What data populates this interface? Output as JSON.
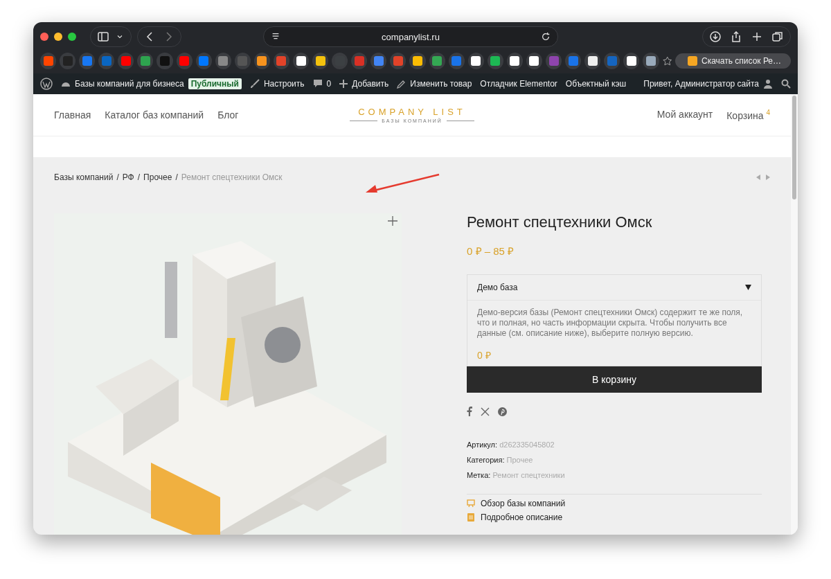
{
  "browser": {
    "address": "companylist.ru",
    "bookmark_tab": "Скачать список Ре…"
  },
  "admin_bar": {
    "site": "Базы компаний для бизнеса",
    "badge": "Публичный",
    "items": [
      {
        "kind": "customize",
        "label": "Настроить"
      },
      {
        "kind": "comments",
        "label": "0"
      },
      {
        "kind": "add",
        "label": "Добавить"
      },
      {
        "kind": "edit",
        "label": "Изменить товар"
      },
      {
        "kind": "plain",
        "label": "Отладчик Elementor"
      },
      {
        "kind": "plain",
        "label": "Объектный кэш"
      }
    ],
    "greeting": "Привет, Администратор сайта"
  },
  "nav": {
    "left": [
      "Главная",
      "Каталог баз компаний",
      "Блог"
    ],
    "logo": {
      "title": "COMPANY LIST",
      "subtitle": "БАЗЫ КОМПАНИЙ"
    },
    "account": "Мой аккаунт",
    "cart": "Корзина",
    "cart_count": "4"
  },
  "breadcrumbs": [
    {
      "label": "Базы компаний",
      "current": false
    },
    {
      "label": "РФ",
      "current": false
    },
    {
      "label": "Прочее",
      "current": false
    },
    {
      "label": "Ремонт спецтехники Омск",
      "current": true
    }
  ],
  "breadcrumb_separator": "/",
  "product": {
    "title": "Ремонт спецтехники Омск",
    "price": "0 ₽ – 85 ₽",
    "variant": "Демо база",
    "description": "Демо-версия базы (Ремонт спецтехники Омск) содержит те же поля, что и полная, но часть информации скрыта. Чтобы получить все данные (см. описание ниже), выберите полную версию.",
    "variant_price": "0 ₽",
    "button": "В корзину",
    "meta": [
      {
        "label": "Артикул:",
        "value": "d262335045802"
      },
      {
        "label": "Категория:",
        "value": "Прочее"
      },
      {
        "label": "Метка:",
        "value": "Ремонт спецтехники"
      }
    ],
    "tabs": [
      {
        "kind": "review",
        "label": "Обзор базы компаний"
      },
      {
        "kind": "description",
        "label": "Подробное описание"
      }
    ]
  }
}
